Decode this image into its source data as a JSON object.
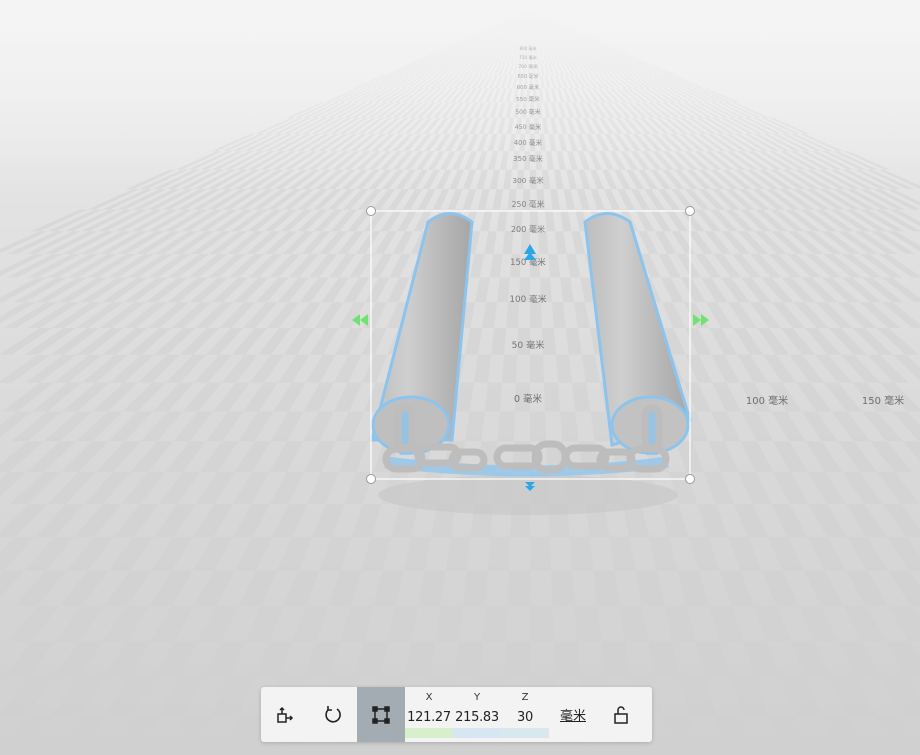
{
  "scene": {
    "ruler_vertical": [
      "0 毫米",
      "50 毫米",
      "100 毫米",
      "150 毫米",
      "200 毫米",
      "250 毫米",
      "300 毫米",
      "350 毫米",
      "400 毫米",
      "450 毫米",
      "500 毫米",
      "550 毫米",
      "600 毫米",
      "650 毫米",
      "700 毫米",
      "750 毫米",
      "800 毫米"
    ],
    "ruler_horizontal": [
      "100 毫米",
      "150 毫米"
    ],
    "model_name": "chain-with-two-cylinders",
    "colors": {
      "selection_outline": "#8cc4ee",
      "move_arrow_blue": "#2aa7e6",
      "move_arrow_green": "#6fe36f"
    }
  },
  "toolbar": {
    "icons": [
      "move-icon",
      "rotate-icon",
      "scale-icon",
      "lock-icon"
    ],
    "active_tool": "scale",
    "x": {
      "axis": "X",
      "value": "121.27",
      "color": "#d8efcc"
    },
    "y": {
      "axis": "Y",
      "value": "215.83",
      "color": "#d7e6f2"
    },
    "z": {
      "axis": "Z",
      "value": "30",
      "color": "#d9e7ef"
    },
    "unit": "毫米"
  }
}
